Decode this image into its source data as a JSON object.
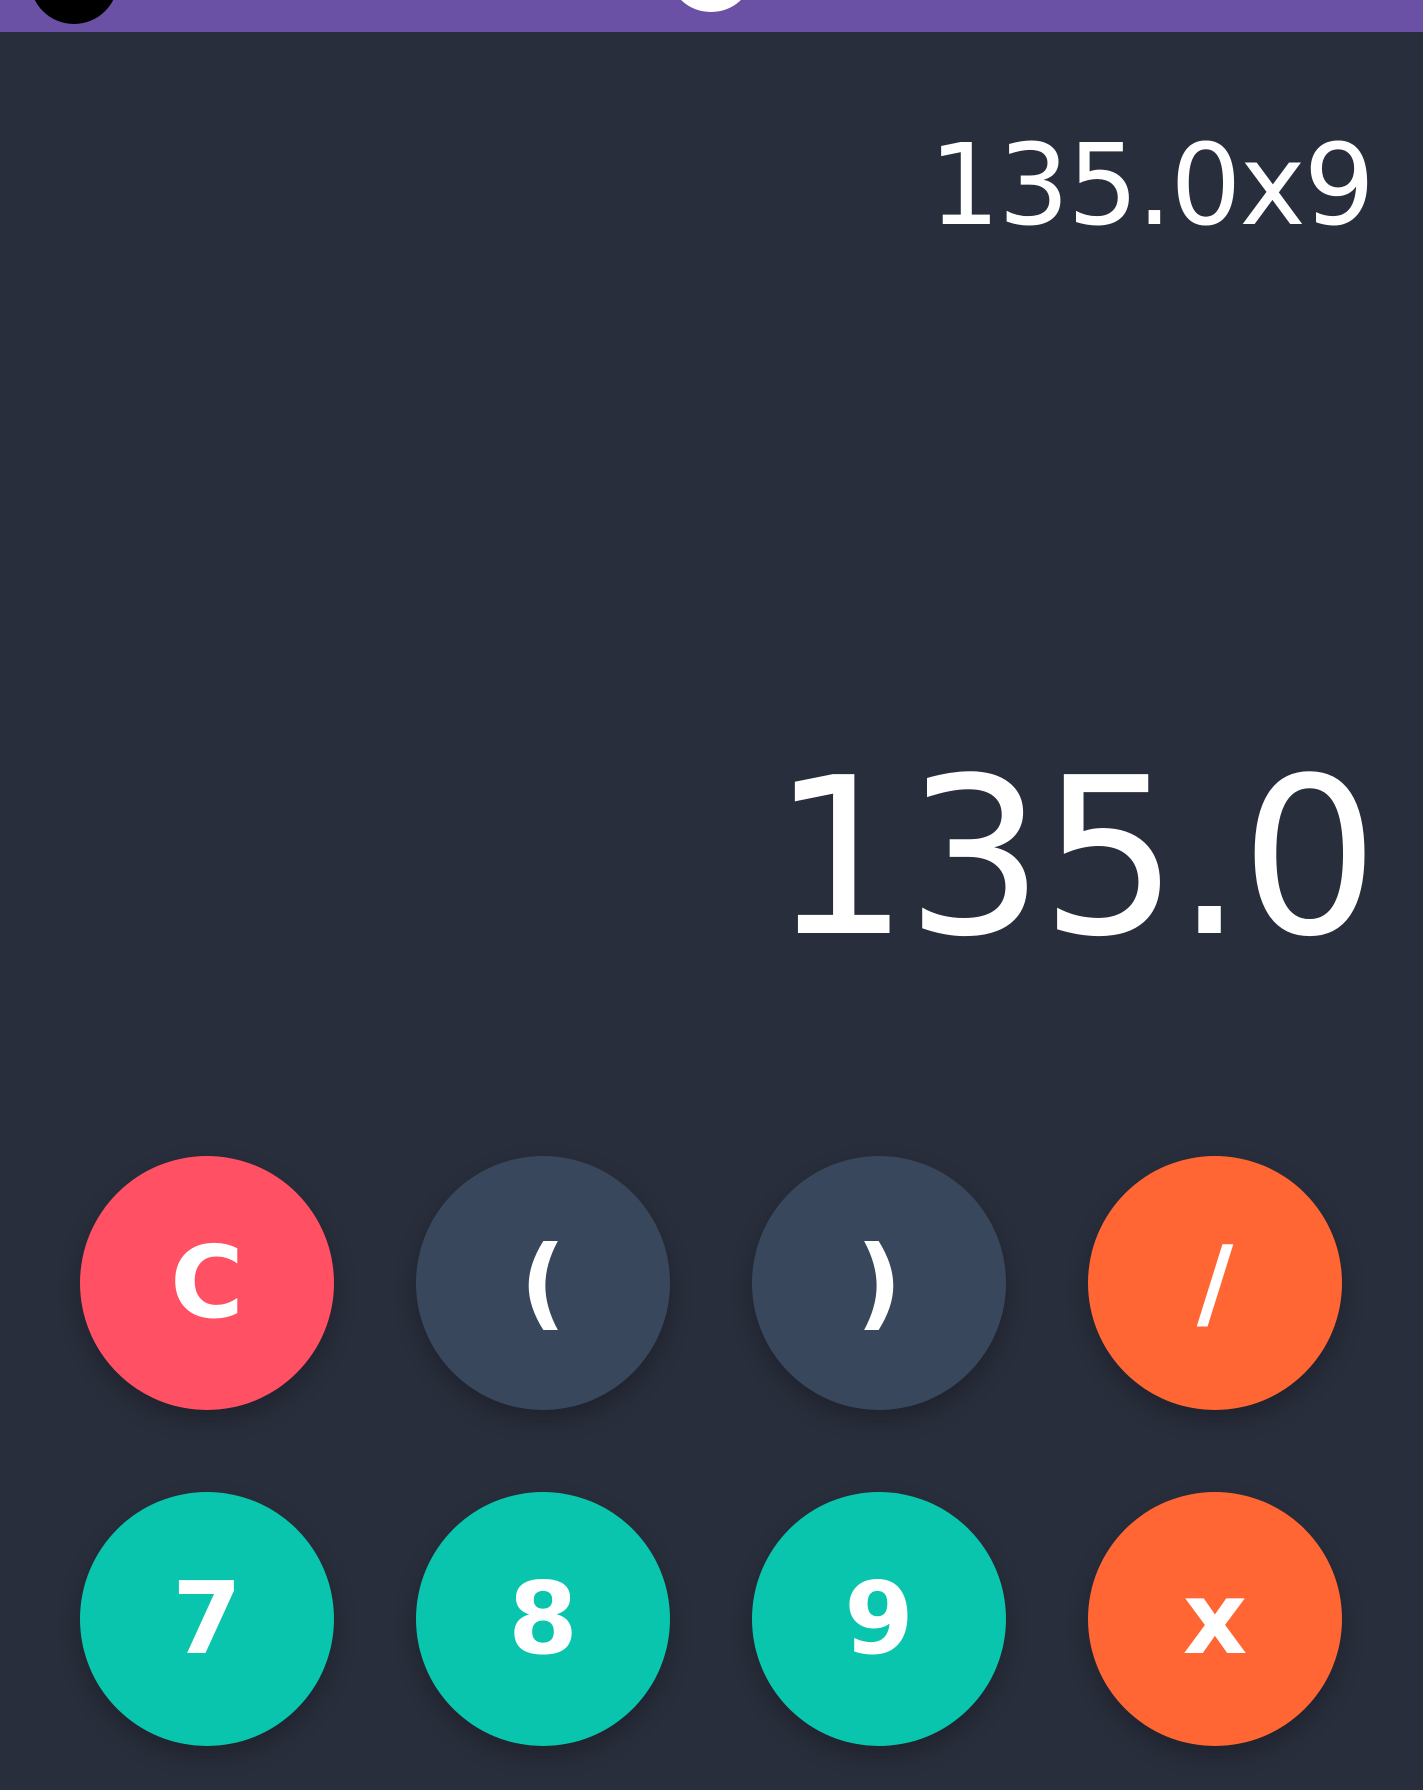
{
  "top_bar": {
    "color": "#6a51a6"
  },
  "display": {
    "expression": "135.0x9",
    "result": "135.0"
  },
  "keypad": {
    "row1": [
      {
        "label": "C",
        "color": "#ff5064"
      },
      {
        "label": "(",
        "color": "#38475b"
      },
      {
        "label": ")",
        "color": "#38475b"
      },
      {
        "label": "/",
        "color": "#ff6633"
      }
    ],
    "row2": [
      {
        "label": "7",
        "color": "#09c5ad"
      },
      {
        "label": "8",
        "color": "#09c5ad"
      },
      {
        "label": "9",
        "color": "#09c5ad"
      },
      {
        "label": "x",
        "color": "#ff6633"
      }
    ]
  },
  "colors": {
    "background": "#292e3c",
    "text": "#ffffff"
  }
}
